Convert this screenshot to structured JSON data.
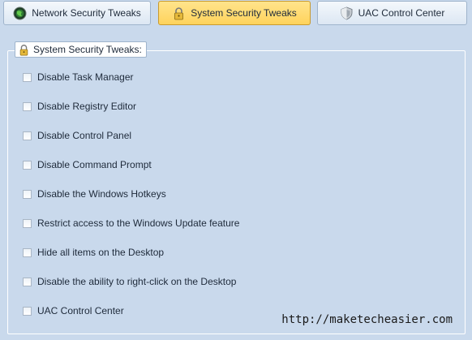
{
  "tabs": [
    {
      "label": "Network Security Tweaks",
      "icon": "globe-icon",
      "active": false
    },
    {
      "label": "System Security Tweaks",
      "icon": "lock-icon",
      "active": true
    },
    {
      "label": "UAC Control Center",
      "icon": "shield-icon",
      "active": false
    }
  ],
  "group": {
    "title": "System Security Tweaks:",
    "icon": "lock-icon"
  },
  "options": [
    {
      "label": "Disable Task Manager",
      "checked": false
    },
    {
      "label": "Disable Registry Editor",
      "checked": false
    },
    {
      "label": "Disable Control Panel",
      "checked": false
    },
    {
      "label": "Disable Command Prompt",
      "checked": false
    },
    {
      "label": "Disable the Windows Hotkeys",
      "checked": false
    },
    {
      "label": "Restrict access to the Windows Update feature",
      "checked": false
    },
    {
      "label": "Hide all items on the Desktop",
      "checked": false
    },
    {
      "label": "Disable the ability to right-click on the Desktop",
      "checked": false
    },
    {
      "label": "UAC Control Center",
      "checked": false
    }
  ],
  "watermark": "http://maketecheasier.com",
  "colors": {
    "background": "#c9d9ec",
    "active_tab": "#ffd35c",
    "tab_border": "#9fb4cc"
  }
}
